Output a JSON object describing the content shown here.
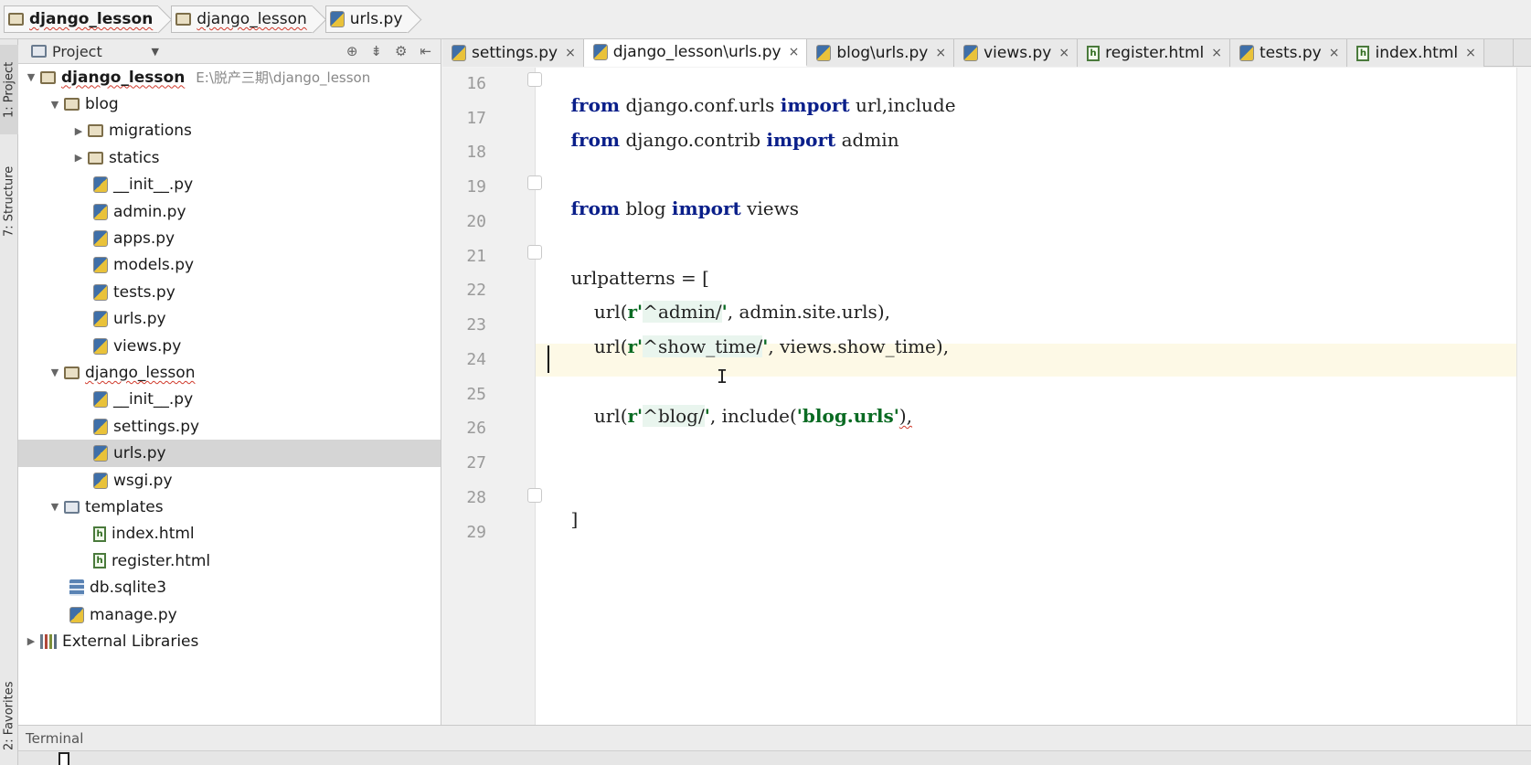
{
  "breadcrumb": {
    "items": [
      {
        "label": "django_lesson",
        "icon": "folder-icon"
      },
      {
        "label": "django_lesson",
        "icon": "folder-icon"
      },
      {
        "label": "urls.py",
        "icon": "python-file-icon"
      }
    ]
  },
  "tool_windows": {
    "project": "1: Project",
    "structure": "7: Structure",
    "favorites": "2: Favorites"
  },
  "project_panel": {
    "view_label": "Project",
    "tree": [
      {
        "label": "django_lesson",
        "path": "E:\\脱产三期\\django_lesson"
      },
      {
        "label": "blog"
      },
      {
        "label": "migrations"
      },
      {
        "label": "statics"
      },
      {
        "label": "__init__.py"
      },
      {
        "label": "admin.py"
      },
      {
        "label": "apps.py"
      },
      {
        "label": "models.py"
      },
      {
        "label": "tests.py"
      },
      {
        "label": "urls.py"
      },
      {
        "label": "views.py"
      },
      {
        "label": "django_lesson"
      },
      {
        "label": "__init__.py"
      },
      {
        "label": "settings.py"
      },
      {
        "label": "urls.py"
      },
      {
        "label": "wsgi.py"
      },
      {
        "label": "templates"
      },
      {
        "label": "index.html"
      },
      {
        "label": "register.html"
      },
      {
        "label": "db.sqlite3"
      },
      {
        "label": "manage.py"
      },
      {
        "label": "External Libraries"
      }
    ]
  },
  "tabs": [
    {
      "label": "settings.py",
      "icon": "python-file-icon"
    },
    {
      "label": "django_lesson\\urls.py",
      "icon": "python-file-icon"
    },
    {
      "label": "blog\\urls.py",
      "icon": "python-file-icon"
    },
    {
      "label": "views.py",
      "icon": "python-file-icon"
    },
    {
      "label": "register.html",
      "icon": "html-file-icon"
    },
    {
      "label": "tests.py",
      "icon": "python-file-icon"
    },
    {
      "label": "index.html",
      "icon": "html-file-icon"
    }
  ],
  "close_glyph": "×",
  "editor": {
    "line_numbers": [
      "16",
      "17",
      "18",
      "19",
      "20",
      "21",
      "22",
      "23",
      "24",
      "25",
      "26",
      "27",
      "28",
      "29"
    ],
    "current_line": "24",
    "lines": {
      "l16": {
        "kw1": "from",
        "t1": " django.conf.urls ",
        "kw2": "import",
        "t2": " url,include"
      },
      "l17": {
        "kw1": "from",
        "t1": " django.contrib ",
        "kw2": "import",
        "t2": " admin"
      },
      "l19": {
        "kw1": "from",
        "t1": " blog ",
        "kw2": "import",
        "t2": " views"
      },
      "l21": {
        "t1": "urlpatterns = ["
      },
      "l22": {
        "t1": "    url(",
        "s1": "r'",
        "rx": "^admin/",
        "s2": "'",
        "t2": ", admin.site.urls),"
      },
      "l23": {
        "t1": "    url(",
        "s1": "r'",
        "rx": "^show_time/",
        "s2": "'",
        "t2": ", views.show_time),"
      },
      "l25": {
        "t1": "    url(",
        "s1": "r'",
        "rx": "^blog/",
        "s2": "'",
        "t2": ", include(",
        "s3": "'blog.urls'",
        "t3": "),"
      },
      "l28": {
        "t1": "]"
      }
    }
  },
  "bottom_panel": {
    "terminal_label": "Terminal"
  },
  "colors": {
    "keyword": "#0a1f8a",
    "string": "#0a6b23",
    "current_line": "#fdf9e6",
    "selection": "#d5d5d5"
  }
}
